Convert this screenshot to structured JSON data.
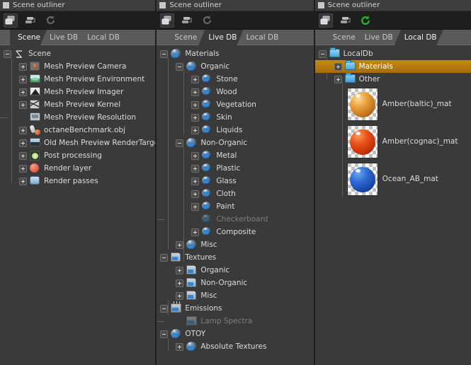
{
  "panels": [
    {
      "title": "Scene outliner",
      "toolbar": [
        {
          "name": "new-outliner-icon",
          "label": "New scene outliner",
          "active": true
        },
        {
          "name": "duplicate-outliner-icon",
          "label": "Duplicate outliner",
          "active": false
        },
        {
          "name": "refresh-icon",
          "label": "Refresh",
          "active": false,
          "color": "#6b6b6b"
        }
      ],
      "tabs": [
        {
          "label": "Scene",
          "active": true
        },
        {
          "label": "Live DB",
          "active": false
        },
        {
          "label": "Local DB",
          "active": false
        }
      ],
      "tree": [
        {
          "label": "Scene",
          "depth": 0,
          "state": "minus",
          "icon": "scene-icon"
        },
        {
          "label": "Mesh Preview Camera",
          "depth": 1,
          "state": "plus",
          "icon": "camera-icon"
        },
        {
          "label": "Mesh Preview Environment",
          "depth": 1,
          "state": "plus",
          "icon": "environment-icon"
        },
        {
          "label": "Mesh Preview Imager",
          "depth": 1,
          "state": "plus",
          "icon": "imager-icon"
        },
        {
          "label": "Mesh Preview Kernel",
          "depth": 1,
          "state": "plus",
          "icon": "kernel-icon"
        },
        {
          "label": "Mesh Preview Resolution",
          "depth": 1,
          "state": "leaf",
          "icon": "resolution-icon"
        },
        {
          "label": "octaneBenchmark.obj",
          "depth": 1,
          "state": "plus",
          "icon": "object-icon"
        },
        {
          "label": "Old Mesh Preview RenderTarget",
          "depth": 1,
          "state": "plus",
          "icon": "rendertarget-icon"
        },
        {
          "label": "Post processing",
          "depth": 1,
          "state": "plus",
          "icon": "postprocess-icon"
        },
        {
          "label": "Render layer",
          "depth": 1,
          "state": "plus",
          "icon": "renderlayer-icon"
        },
        {
          "label": "Render passes",
          "depth": 1,
          "state": "plus",
          "icon": "renderpasses-icon"
        }
      ]
    },
    {
      "title": "Scene outliner",
      "toolbar": [
        {
          "name": "new-outliner-icon",
          "label": "New scene outliner",
          "active": true
        },
        {
          "name": "duplicate-outliner-icon",
          "label": "Duplicate outliner",
          "active": false
        },
        {
          "name": "refresh-icon",
          "label": "Refresh",
          "active": false,
          "color": "#6b6b6b"
        }
      ],
      "tabs": [
        {
          "label": "Scene",
          "active": false
        },
        {
          "label": "Live DB",
          "active": true
        },
        {
          "label": "Local DB",
          "active": false
        }
      ],
      "tree": [
        {
          "label": "Materials",
          "depth": 0,
          "state": "minus",
          "icon": "material-icon"
        },
        {
          "label": "Organic",
          "depth": 1,
          "state": "minus",
          "icon": "material-icon"
        },
        {
          "label": "Stone",
          "depth": 2,
          "state": "plus",
          "icon": "material-icon"
        },
        {
          "label": "Wood",
          "depth": 2,
          "state": "plus",
          "icon": "material-icon"
        },
        {
          "label": "Vegetation",
          "depth": 2,
          "state": "plus",
          "icon": "material-icon"
        },
        {
          "label": "Skin",
          "depth": 2,
          "state": "plus",
          "icon": "material-icon"
        },
        {
          "label": "Liquids",
          "depth": 2,
          "state": "plus",
          "icon": "material-icon"
        },
        {
          "label": "Non-Organic",
          "depth": 1,
          "state": "minus",
          "icon": "material-icon"
        },
        {
          "label": "Metal",
          "depth": 2,
          "state": "plus",
          "icon": "material-icon"
        },
        {
          "label": "Plastic",
          "depth": 2,
          "state": "plus",
          "icon": "material-icon"
        },
        {
          "label": "Glass",
          "depth": 2,
          "state": "plus",
          "icon": "material-icon"
        },
        {
          "label": "Cloth",
          "depth": 2,
          "state": "plus",
          "icon": "material-icon"
        },
        {
          "label": "Paint",
          "depth": 2,
          "state": "plus",
          "icon": "material-icon"
        },
        {
          "label": "Checkerboard",
          "depth": 2,
          "state": "leaf",
          "icon": "material-icon",
          "dim": true
        },
        {
          "label": "Composite",
          "depth": 2,
          "state": "plus",
          "icon": "material-icon"
        },
        {
          "label": "Misc",
          "depth": 1,
          "state": "plus",
          "icon": "material-icon"
        },
        {
          "label": "Textures",
          "depth": 0,
          "state": "minus",
          "icon": "texture-icon"
        },
        {
          "label": "Organic",
          "depth": 1,
          "state": "plus",
          "icon": "texture-icon"
        },
        {
          "label": "Non-Organic",
          "depth": 1,
          "state": "plus",
          "icon": "texture-icon"
        },
        {
          "label": "Misc",
          "depth": 1,
          "state": "plus",
          "icon": "texture-icon"
        },
        {
          "label": "Emissions",
          "depth": 0,
          "state": "minus",
          "icon": "emission-icon"
        },
        {
          "label": "Lamp Spectra",
          "depth": 1,
          "state": "leaf",
          "icon": "emission-icon",
          "dim": true
        },
        {
          "label": "OTOY",
          "depth": 0,
          "state": "minus",
          "icon": "material-icon"
        },
        {
          "label": "Absolute Textures",
          "depth": 1,
          "state": "plus",
          "icon": "material-icon"
        }
      ]
    },
    {
      "title": "Scene outliner",
      "toolbar": [
        {
          "name": "new-outliner-icon",
          "label": "New scene outliner",
          "active": true
        },
        {
          "name": "duplicate-outliner-icon",
          "label": "Duplicate outliner",
          "active": false
        },
        {
          "name": "refresh-icon",
          "label": "Refresh",
          "active": false,
          "color": "#35aa35"
        }
      ],
      "tabs": [
        {
          "label": "Scene",
          "active": false
        },
        {
          "label": "Live DB",
          "active": false
        },
        {
          "label": "Local DB",
          "active": true
        }
      ],
      "tree": [
        {
          "label": "LocalDb",
          "depth": 0,
          "state": "minus",
          "icon": "folder-icon"
        },
        {
          "label": "Materials",
          "depth": 1,
          "state": "plus",
          "icon": "folder-icon",
          "selected": true
        },
        {
          "label": "Other",
          "depth": 1,
          "state": "plus",
          "icon": "folder-icon"
        },
        {
          "label": "Amber(baltic)_mat",
          "depth": 2,
          "state": "leaf",
          "icon": "material-thumbnail",
          "thumb": "#d98a2b"
        },
        {
          "label": "Amber(cognac)_mat",
          "depth": 2,
          "state": "leaf",
          "icon": "material-thumbnail",
          "thumb": "#d2400e"
        },
        {
          "label": "Ocean_AB_mat",
          "depth": 2,
          "state": "leaf",
          "icon": "material-thumbnail",
          "thumb": "#1b4fc0"
        }
      ]
    }
  ],
  "colors": {
    "selection": "#b5780c",
    "panel_bg": "#3a3a3a",
    "toolbar_bg": "#1e1e1e",
    "tabstrip_bg": "#5a5a5a",
    "text": "#dcdcdc",
    "text_dim": "#7d7d7d",
    "refresh_active": "#35aa35"
  }
}
